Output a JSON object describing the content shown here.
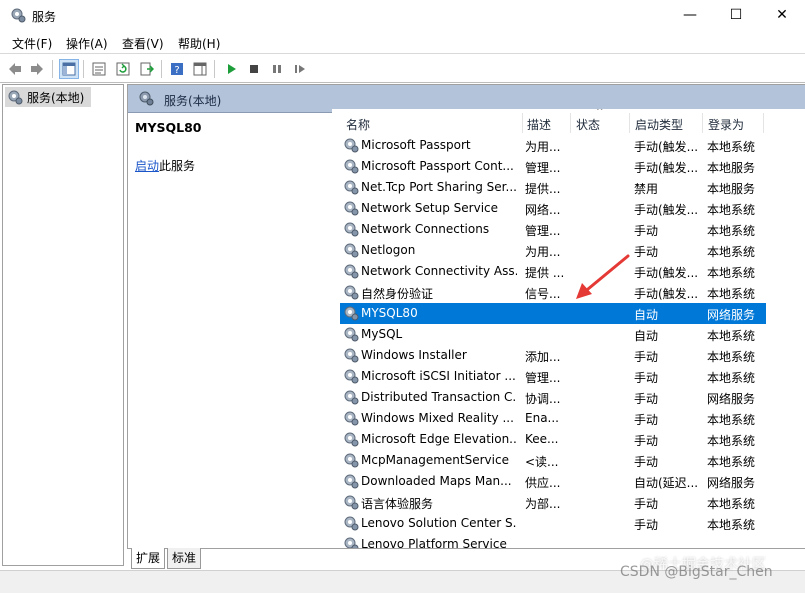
{
  "window": {
    "title": "服务",
    "minimize_glyph": "—",
    "maximize_glyph": "☐",
    "close_glyph": "✕"
  },
  "menu": [
    "文件(F)",
    "操作(A)",
    "查看(V)",
    "帮助(H)"
  ],
  "tree": {
    "item": "服务(本地)"
  },
  "panel": {
    "header": "服务(本地)",
    "selected_name": "MYSQL80",
    "action_link": "启动",
    "action_suffix": "此服务"
  },
  "columns": {
    "name": "名称",
    "desc": "描述",
    "status": "状态",
    "startup": "启动类型",
    "logon": "登录为"
  },
  "services": [
    {
      "name": "Microsoft Passport",
      "desc": "为用...",
      "status": "",
      "startup": "手动(触发...",
      "logon": "本地系统"
    },
    {
      "name": "Microsoft Passport Cont...",
      "desc": "管理...",
      "status": "",
      "startup": "手动(触发...",
      "logon": "本地服务"
    },
    {
      "name": "Net.Tcp Port Sharing Ser...",
      "desc": "提供...",
      "status": "",
      "startup": "禁用",
      "logon": "本地服务"
    },
    {
      "name": "Network Setup Service",
      "desc": "网络...",
      "status": "",
      "startup": "手动(触发...",
      "logon": "本地系统"
    },
    {
      "name": "Network Connections",
      "desc": "管理...",
      "status": "",
      "startup": "手动",
      "logon": "本地系统"
    },
    {
      "name": "Netlogon",
      "desc": "为用...",
      "status": "",
      "startup": "手动",
      "logon": "本地系统"
    },
    {
      "name": "Network Connectivity Ass...",
      "desc": "提供 ...",
      "status": "",
      "startup": "手动(触发...",
      "logon": "本地系统"
    },
    {
      "name": "自然身份验证",
      "desc": "信号...",
      "status": "",
      "startup": "手动(触发...",
      "logon": "本地系统"
    },
    {
      "name": "MYSQL80",
      "desc": "",
      "status": "",
      "startup": "自动",
      "logon": "网络服务"
    },
    {
      "name": "MySQL",
      "desc": "",
      "status": "",
      "startup": "自动",
      "logon": "本地系统"
    },
    {
      "name": "Windows Installer",
      "desc": "添加...",
      "status": "",
      "startup": "手动",
      "logon": "本地系统"
    },
    {
      "name": "Microsoft iSCSI Initiator ...",
      "desc": "管理...",
      "status": "",
      "startup": "手动",
      "logon": "本地系统"
    },
    {
      "name": "Distributed Transaction C...",
      "desc": "协调...",
      "status": "",
      "startup": "手动",
      "logon": "网络服务"
    },
    {
      "name": "Windows Mixed Reality ...",
      "desc": "Ena...",
      "status": "",
      "startup": "手动",
      "logon": "本地系统"
    },
    {
      "name": "Microsoft Edge Elevation...",
      "desc": "Kee...",
      "status": "",
      "startup": "手动",
      "logon": "本地系统"
    },
    {
      "name": "McpManagementService",
      "desc": "<读...",
      "status": "",
      "startup": "手动",
      "logon": "本地系统"
    },
    {
      "name": "Downloaded Maps Man...",
      "desc": "供应...",
      "status": "",
      "startup": "自动(延迟...",
      "logon": "网络服务"
    },
    {
      "name": "语言体验服务",
      "desc": "为部...",
      "status": "",
      "startup": "手动",
      "logon": "本地系统"
    },
    {
      "name": "Lenovo Solution Center S...",
      "desc": "",
      "status": "",
      "startup": "手动",
      "logon": "本地系统"
    },
    {
      "name": "Lenovo Platform Service",
      "desc": "",
      "status": "",
      "startup": "",
      "logon": ""
    }
  ],
  "selected_index": 8,
  "tabs": [
    "扩展",
    "标准"
  ],
  "watermark": {
    "line1": "@稀土掘金技术社区",
    "line2": "CSDN @BigStar_Chen"
  },
  "colors": {
    "selection": "#0078d7",
    "header": "#b3c3d9",
    "arrow": "#e53935",
    "play": "#1e9e3a"
  }
}
